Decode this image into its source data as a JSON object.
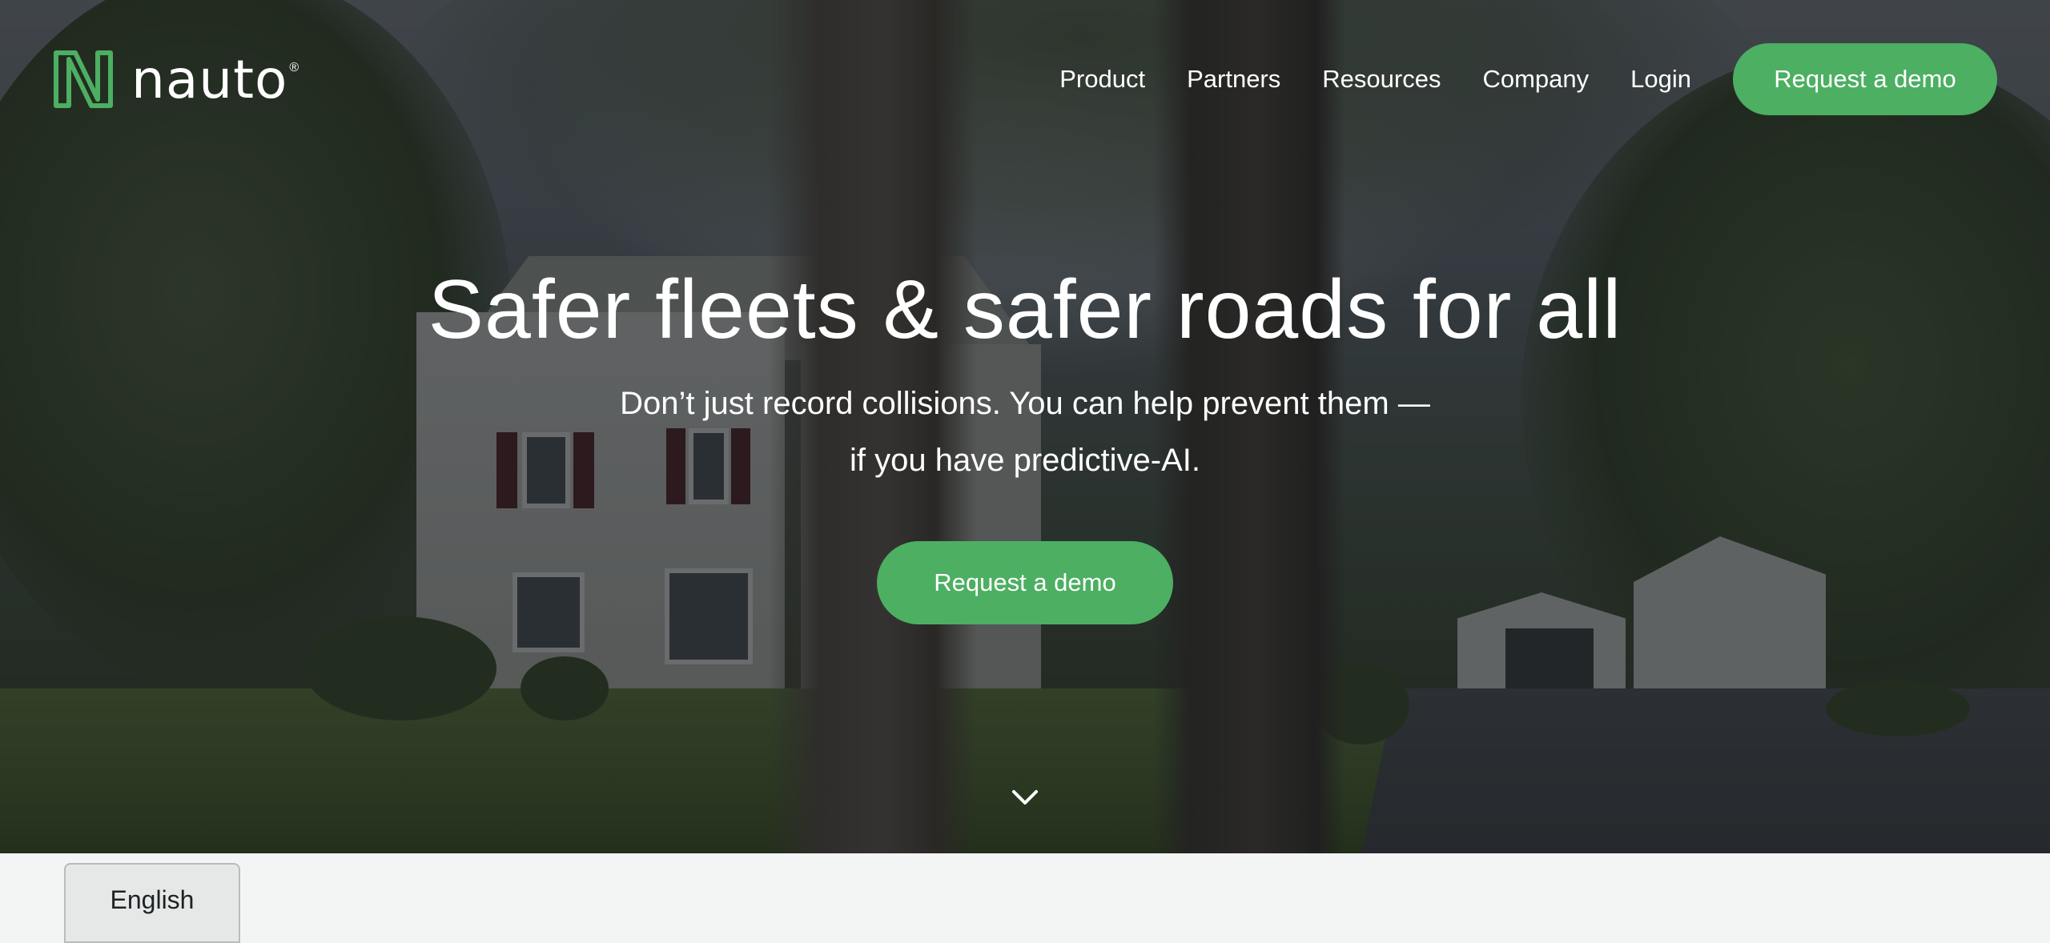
{
  "brand": {
    "name": "nauto",
    "registered": "®",
    "logo_icon": "nauto-n-logo-icon",
    "accent_color": "#4caf62"
  },
  "nav": {
    "items": [
      {
        "label": "Product"
      },
      {
        "label": "Partners"
      },
      {
        "label": "Resources"
      },
      {
        "label": "Company"
      },
      {
        "label": "Login"
      }
    ],
    "cta_label": "Request a demo"
  },
  "hero": {
    "headline": "Safer fleets & safer roads for all",
    "subline_1": "Don’t just record collisions. You can help prevent them —",
    "subline_2": "if you have predictive-AI.",
    "cta_label": "Request a demo",
    "scroll_icon": "chevron-down-icon"
  },
  "language": {
    "selected": "English"
  }
}
